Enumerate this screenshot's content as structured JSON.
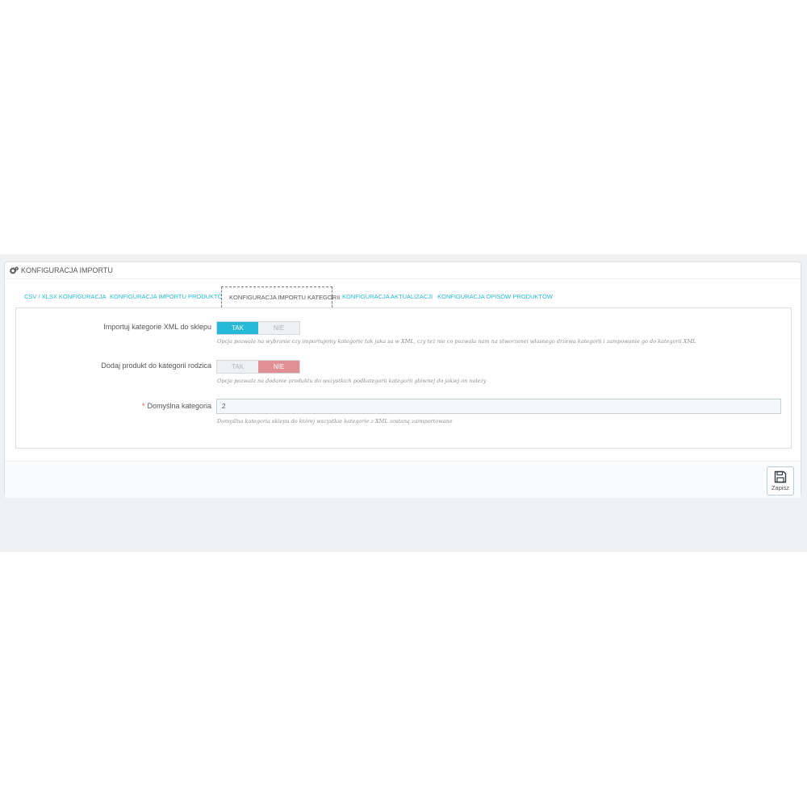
{
  "panel": {
    "title": "KONFIGURACJA IMPORTU",
    "icon": "cogs-icon"
  },
  "tabs": [
    {
      "label": "CSV / XLSX KONFIGURACJA",
      "active": false
    },
    {
      "label": "KONFIGURACJA IMPORTU PRODUKTÓW",
      "active": false
    },
    {
      "label": "KONFIGURACJA IMPORTU KATEGORII",
      "active": true
    },
    {
      "label": "KONFIGURACJA AKTUALIZACJI",
      "active": false
    },
    {
      "label": "KONFIGURACJA OPISÓW PRODUKTÓW",
      "active": false
    }
  ],
  "form": {
    "import_categories": {
      "label": "Importuj kategorie XML do sklepu",
      "yes": "TAK",
      "no": "NIE",
      "selected": "TAK",
      "help": "Opcja pozwala na wybranie czy importujemy kategorie tak jaka sa w XML, czy też nie co pozwala nam na stworzenei własnego drzewa kategorii i zampowanie go do kategorii XML"
    },
    "add_to_parent": {
      "label": "Dodaj produkt do kategorii rodzica",
      "yes": "TAK",
      "no": "NIE",
      "selected": "NIE",
      "help": "Opcja pozwala na dodanie produktu do wszystkich podkategorii kategorii głównej do jakiej on należy"
    },
    "default_category": {
      "required_mark": "*",
      "label": "Domyślna kategoria",
      "value": "2",
      "help": "Domyślna kategoria sklepu do której wszystkie kategorie z XML zostaną zaimportowane"
    }
  },
  "footer": {
    "save_label": "Zapisz",
    "save_icon": "floppy-disk-icon"
  },
  "colors": {
    "accent": "#25b9d7",
    "no_active": "#e08f95",
    "background": "#eff1f2"
  }
}
